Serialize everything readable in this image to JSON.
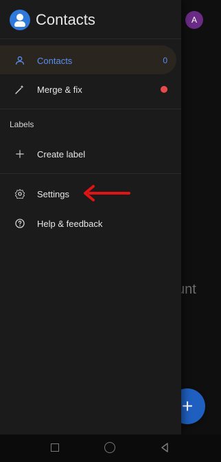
{
  "app": {
    "title": "Contacts",
    "avatar_letter": "A"
  },
  "drawer": {
    "items_top": [
      {
        "label": "Contacts",
        "badge": "0"
      },
      {
        "label": "Merge & fix"
      }
    ],
    "labels_section_title": "Labels",
    "create_label": "Create label",
    "items_bottom": [
      {
        "label": "Settings"
      },
      {
        "label": "Help & feedback"
      }
    ]
  },
  "background": {
    "partial_text": "unt"
  },
  "colors": {
    "accent_blue": "#5a8ff0",
    "logo_blue": "#2e79d9",
    "fab_blue": "#1f5fbf",
    "avatar_purple": "#6a2b86",
    "notification_red": "#e84a4a"
  },
  "icons": {
    "logo": "contacts-logo-icon",
    "contacts": "person-outline-icon",
    "merge_fix": "magic-wand-icon",
    "create_label": "plus-icon",
    "settings": "gear-icon",
    "help": "help-circle-icon",
    "fab": "add-icon",
    "nav_recent": "square-icon",
    "nav_home": "circle-icon",
    "nav_back": "triangle-left-icon",
    "annotation": "arrow-left-icon"
  }
}
